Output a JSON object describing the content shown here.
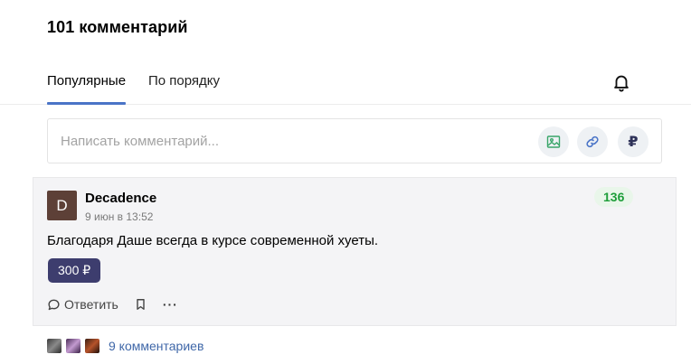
{
  "header": {
    "title": "101 комментарий"
  },
  "tabs": [
    {
      "label": "Популярные",
      "active": true
    },
    {
      "label": "По порядку",
      "active": false
    }
  ],
  "icons": {
    "bell": "bell-icon",
    "image": "image-icon",
    "link": "link-icon",
    "reply": "speech-bubble-icon",
    "bookmark": "bookmark-icon",
    "more": "more-dots-icon"
  },
  "composer": {
    "placeholder": "Написать комментарий...",
    "rub_symbol": "₽"
  },
  "comment": {
    "avatar_letter": "D",
    "author": "Decadence",
    "date": "9 июн в 13:52",
    "rating": "136",
    "text": "Благодаря Даше всегда в курсе современной хуеты.",
    "donation": "300 ₽",
    "reply_label": "Ответить",
    "more_label": "···"
  },
  "thread": {
    "link_label": "9 комментариев"
  },
  "colors": {
    "accent": "#4a74c7",
    "rating_green": "#1e9e3a",
    "donate_bg": "#3d3d6e",
    "link": "#3f67a8"
  }
}
